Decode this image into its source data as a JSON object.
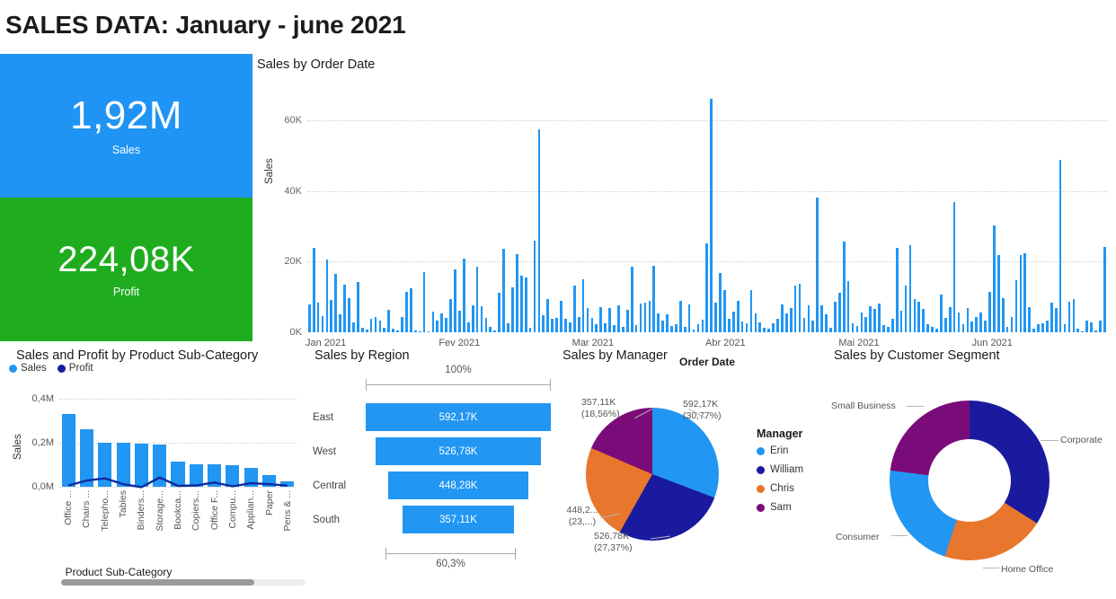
{
  "header": {
    "title": "SALES DATA: January - june 2021"
  },
  "colors": {
    "blue": "#2196f3",
    "kpi_blue": "#1f94f5",
    "green": "#1fad1f",
    "navy": "#1a1a9e",
    "orange": "#e8762c",
    "purple": "#7a0c7a",
    "profit_line": "#0d2b9e"
  },
  "kpi": {
    "sales": {
      "value": "1,92M",
      "label": "Sales"
    },
    "profit": {
      "value": "224,08K",
      "label": "Profit"
    }
  },
  "chart_data": [
    {
      "id": "sales_by_order_date",
      "type": "bar",
      "title": "Sales by Order Date",
      "xlabel": "Order Date",
      "ylabel": "Sales",
      "ylim": [
        0,
        70000
      ],
      "grid": true,
      "yticks": [
        "0K",
        "20K",
        "40K",
        "60K"
      ],
      "ytick_values": [
        0,
        20000,
        40000,
        60000
      ],
      "xticks": [
        "Jan 2021",
        "Fev 2021",
        "Mar 2021",
        "Abr 2021",
        "Mai 2021",
        "Jun 2021"
      ],
      "values": [
        7800,
        24000,
        8500,
        4600,
        20500,
        9200,
        16500,
        5100,
        13500,
        9600,
        2700,
        14300,
        1200,
        800,
        3800,
        4400,
        3200,
        1400,
        6300,
        1000,
        500,
        4400,
        11400,
        12500,
        400,
        300,
        17000,
        200,
        5800,
        3300,
        5400,
        4200,
        9400,
        17800,
        6100,
        21000,
        2800,
        7700,
        18500,
        7500,
        4000,
        1500,
        600,
        11200,
        23800,
        2500,
        12800,
        22200,
        16000,
        15600,
        1300,
        26000,
        57500,
        4900,
        9300,
        3900,
        4200,
        9000,
        3700,
        2800,
        13300,
        4400,
        15000,
        6800,
        4200,
        2300,
        7200,
        2600,
        6800,
        2000,
        7600,
        1500,
        6300,
        18500,
        2100,
        8200,
        8300,
        9000,
        18800,
        5400,
        3300,
        5200,
        1800,
        2400,
        8900,
        1600,
        7900,
        800,
        2200,
        3500,
        25200,
        66200,
        8500,
        16800,
        11900,
        3700,
        5800,
        8900,
        3100,
        2600,
        12000,
        5400,
        2900,
        1300,
        900,
        2600,
        3700,
        7900,
        5300,
        6800,
        13300,
        13800,
        4200,
        7600,
        3400,
        38300,
        7700,
        5200,
        1200,
        8600,
        11100,
        25600,
        14600,
        2600,
        1900,
        5600,
        4300,
        7400,
        6600,
        8200,
        2100,
        1600,
        3900,
        23900,
        6200,
        13200,
        24800,
        9500,
        8700,
        6700,
        2300,
        1600,
        900,
        10700,
        4000,
        7200,
        37000,
        5700,
        2300,
        7000,
        3100,
        4300,
        5600,
        3200,
        11500,
        30400,
        21800,
        9600,
        1500,
        4300,
        14800,
        22000,
        22500,
        7200,
        900,
        2200,
        2500,
        3200,
        8400,
        7000,
        48900,
        2200,
        8700,
        9300,
        1000,
        300,
        3400,
        2700,
        400,
        3300,
        24100
      ]
    },
    {
      "id": "sales_profit_by_subcategory",
      "type": "bar",
      "title": "Sales and Profit by Product Sub-Category",
      "xlabel": "Product Sub-Category",
      "ylabel": "Sales",
      "ylim": [
        0,
        0.4
      ],
      "grid": true,
      "yticks": [
        "0,0M",
        "0,2M",
        "0,4M"
      ],
      "ytick_values": [
        0.0,
        0.2,
        0.4
      ],
      "legend": [
        "Sales",
        "Profit"
      ],
      "legend_position": "top-left",
      "categories": [
        "Office ...",
        "Chairs ...",
        "Telepho...",
        "Tables",
        "Binders...",
        "Storage...",
        "Bookca...",
        "Copiers...",
        "Office F...",
        "Compu...",
        "Applian...",
        "Paper",
        "Pens & ..."
      ],
      "series": [
        {
          "name": "Sales",
          "values": [
            0.332,
            0.262,
            0.201,
            0.2,
            0.194,
            0.19,
            0.113,
            0.101,
            0.101,
            0.098,
            0.086,
            0.054,
            0.024
          ]
        },
        {
          "name": "Profit",
          "values": [
            0.006,
            0.028,
            0.038,
            0.012,
            -0.002,
            0.042,
            0.004,
            0.006,
            0.019,
            0.002,
            0.016,
            0.012,
            0.005
          ]
        }
      ]
    },
    {
      "id": "sales_by_region",
      "type": "bar",
      "title": "Sales by Region",
      "categories": [
        "East",
        "West",
        "Central",
        "South"
      ],
      "values": [
        592170,
        526780,
        448280,
        357110
      ],
      "value_labels": [
        "592,17K",
        "526,78K",
        "448,28K",
        "357,11K"
      ],
      "top_measure": "100%",
      "bottom_measure": "60,3%"
    },
    {
      "id": "sales_by_manager",
      "type": "pie",
      "title": "Sales by Manager",
      "legend_title": "Manager",
      "legend_position": "right",
      "labels": [
        "Erin",
        "William",
        "Chris",
        "Sam"
      ],
      "values": [
        592170,
        526780,
        448280,
        357110
      ],
      "percents": [
        30.77,
        27.37,
        23.3,
        18.56
      ],
      "callouts": [
        {
          "value": "592,17K",
          "percent": "(30,77%)"
        },
        {
          "value": "526,78K",
          "percent": "(27,37%)"
        },
        {
          "value": "448,2...",
          "percent": "(23,...)"
        },
        {
          "value": "357,11K",
          "percent": "(18,56%)"
        }
      ]
    },
    {
      "id": "sales_by_customer_segment",
      "type": "pie",
      "title": "Sales by Customer Segment",
      "labels": [
        "Corporate",
        "Home Office",
        "Consumer",
        "Small Business"
      ],
      "percents": [
        34,
        21,
        22,
        23
      ]
    }
  ]
}
